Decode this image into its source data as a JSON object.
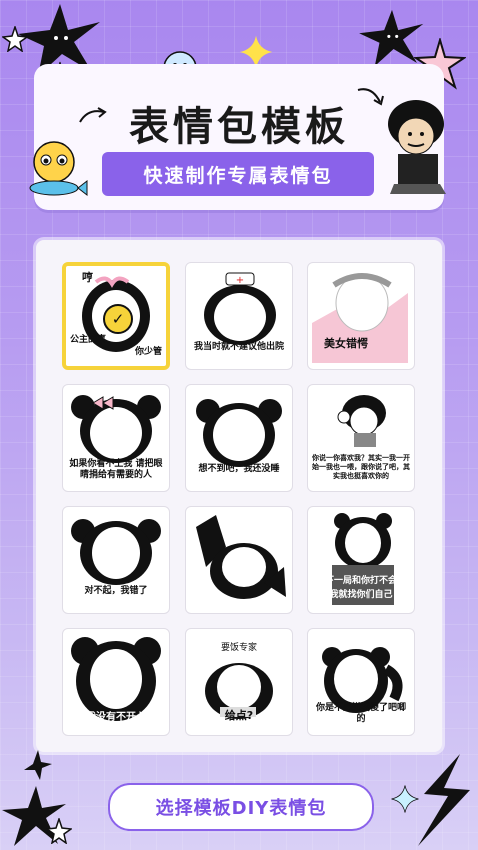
{
  "header": {
    "title": "表情包模板",
    "subtitle": "快速制作专属表情包"
  },
  "templates": [
    {
      "caption": "公主的事",
      "caption2": "你少管",
      "top_text": "哼",
      "selected": true
    },
    {
      "caption": "我当时就不建议他出院",
      "selected": false
    },
    {
      "caption": "美女错愕",
      "selected": false
    },
    {
      "caption": "如果你看不上我 请把眼睛捐给有需要的人",
      "selected": false
    },
    {
      "caption": "想不到吧，我还没睡",
      "selected": false
    },
    {
      "caption": "你说一你喜欢我？其实一我一开始一我也一喂，跟你说了吧，其实我也挺喜欢你的",
      "selected": false
    },
    {
      "caption": "对不起，我错了",
      "selected": false
    },
    {
      "caption": "",
      "selected": false
    },
    {
      "caption": "下一局和你打不会",
      "caption2": "我就找你们自己",
      "selected": false
    },
    {
      "caption": "我没有不开心",
      "selected": false
    },
    {
      "caption": "给点?",
      "top_text": "要饭专家",
      "selected": false
    },
    {
      "caption": "你是不是嫌我傻了吧唧的",
      "selected": false
    }
  ],
  "cta": {
    "label": "选择模板DIY表情包"
  },
  "colors": {
    "accent": "#8a62ea",
    "selected": "#f6d33a"
  }
}
